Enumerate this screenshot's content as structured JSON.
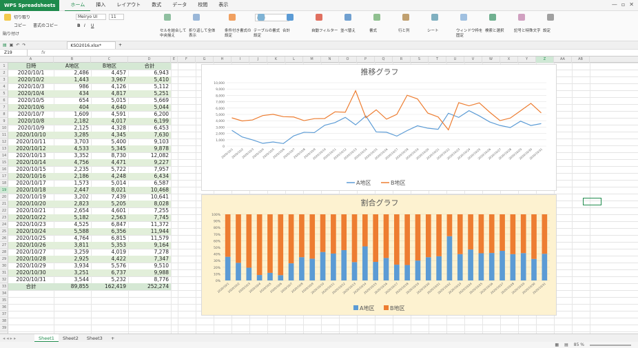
{
  "app": {
    "name": "WPS Spreadsheets",
    "menu": [
      "ホーム",
      "挿入",
      "レイアウト",
      "数式",
      "データ",
      "校閲",
      "表示"
    ],
    "active_menu": 0
  },
  "ribbon": {
    "clipboard": [
      "切り取り",
      "コピー",
      "書式のコピー",
      "貼り付け"
    ],
    "font_name": "Meiryo UI",
    "font_size": "11",
    "number_format": "標準",
    "buttons": [
      "セルを結合して中央揃え",
      "折り返して全体表示",
      "条件付き書式の設定",
      "テーブルの書式設定",
      "合計",
      "自動フィルター",
      "並べ替え",
      "書式",
      "行と列",
      "シート",
      "ウィンドウ枠を固定",
      "検索と選択",
      "記号と特殊文字",
      "設定"
    ]
  },
  "file": {
    "name": "KSO2016.xlsx*"
  },
  "namebox": "Z19",
  "fx": "fx",
  "columns": [
    "A",
    "B",
    "C",
    "D",
    "E",
    "F",
    "G",
    "H",
    "I",
    "J",
    "K",
    "L",
    "M",
    "N",
    "O",
    "P",
    "Q",
    "R",
    "S",
    "T",
    "U",
    "V",
    "W",
    "X",
    "Y",
    "Z",
    "AA",
    "AB"
  ],
  "selected_column": "Z",
  "table": {
    "headers": [
      "日時",
      "A地区",
      "B地区",
      "合計"
    ],
    "rows": [
      [
        "2020/10/1",
        "2,486",
        "4,457",
        "6,943"
      ],
      [
        "2020/10/2",
        "1,443",
        "3,967",
        "5,410"
      ],
      [
        "2020/10/3",
        "986",
        "4,126",
        "5,112"
      ],
      [
        "2020/10/4",
        "434",
        "4,817",
        "5,251"
      ],
      [
        "2020/10/5",
        "654",
        "5,015",
        "5,669"
      ],
      [
        "2020/10/6",
        "404",
        "4,640",
        "5,044"
      ],
      [
        "2020/10/7",
        "1,609",
        "4,591",
        "6,200"
      ],
      [
        "2020/10/8",
        "2,182",
        "4,017",
        "6,199"
      ],
      [
        "2020/10/9",
        "2,125",
        "4,328",
        "6,453"
      ],
      [
        "2020/10/10",
        "3,285",
        "4,345",
        "7,630"
      ],
      [
        "2020/10/11",
        "3,703",
        "5,400",
        "9,103"
      ],
      [
        "2020/10/12",
        "4,533",
        "5,345",
        "9,878"
      ],
      [
        "2020/10/13",
        "3,352",
        "8,730",
        "12,082"
      ],
      [
        "2020/10/14",
        "4,756",
        "4,471",
        "9,227"
      ],
      [
        "2020/10/15",
        "2,235",
        "5,722",
        "7,957"
      ],
      [
        "2020/10/16",
        "2,186",
        "4,248",
        "6,434"
      ],
      [
        "2020/10/17",
        "1,573",
        "5,014",
        "6,587"
      ],
      [
        "2020/10/18",
        "2,447",
        "8,021",
        "10,468"
      ],
      [
        "2020/10/19",
        "3,202",
        "7,439",
        "10,641"
      ],
      [
        "2020/10/20",
        "2,823",
        "5,205",
        "8,028"
      ],
      [
        "2020/10/21",
        "2,654",
        "4,601",
        "7,255"
      ],
      [
        "2020/10/22",
        "5,182",
        "2,563",
        "7,745"
      ],
      [
        "2020/10/23",
        "4,525",
        "6,847",
        "11,372"
      ],
      [
        "2020/10/24",
        "5,588",
        "6,356",
        "11,944"
      ],
      [
        "2020/10/25",
        "4,764",
        "6,815",
        "11,579"
      ],
      [
        "2020/10/26",
        "3,811",
        "5,353",
        "9,164"
      ],
      [
        "2020/10/27",
        "3,259",
        "4,019",
        "7,278"
      ],
      [
        "2020/10/28",
        "2,925",
        "4,422",
        "7,347"
      ],
      [
        "2020/10/29",
        "3,934",
        "5,576",
        "9,510"
      ],
      [
        "2020/10/30",
        "3,251",
        "6,737",
        "9,988"
      ],
      [
        "2020/10/31",
        "3,544",
        "5,232",
        "8,776"
      ]
    ],
    "total": [
      "合計",
      "89,855",
      "162,419",
      "252,274"
    ]
  },
  "chart_data": [
    {
      "type": "line",
      "title": "推移グラフ",
      "x": [
        "2020/10/1",
        "2020/10/2",
        "2020/10/3",
        "2020/10/4",
        "2020/10/5",
        "2020/10/6",
        "2020/10/7",
        "2020/10/8",
        "2020/10/9",
        "2020/10/10",
        "2020/10/11",
        "2020/10/12",
        "2020/10/13",
        "2020/10/14",
        "2020/10/15",
        "2020/10/16",
        "2020/10/17",
        "2020/10/18",
        "2020/10/19",
        "2020/10/20",
        "2020/10/21",
        "2020/10/22",
        "2020/10/23",
        "2020/10/24",
        "2020/10/25",
        "2020/10/26",
        "2020/10/27",
        "2020/10/28",
        "2020/10/29",
        "2020/10/30",
        "2020/10/31"
      ],
      "series": [
        {
          "name": "A地区",
          "color": "#5b9bd5",
          "values": [
            2486,
            1443,
            986,
            434,
            654,
            404,
            1609,
            2182,
            2125,
            3285,
            3703,
            4533,
            3352,
            4756,
            2235,
            2186,
            1573,
            2447,
            3202,
            2823,
            2654,
            5182,
            4525,
            5588,
            4764,
            3811,
            3259,
            2925,
            3934,
            3251,
            3544
          ]
        },
        {
          "name": "B地区",
          "color": "#ed7d31",
          "values": [
            4457,
            3967,
            4126,
            4817,
            5015,
            4640,
            4591,
            4017,
            4328,
            4345,
            5400,
            5345,
            8730,
            4471,
            5722,
            4248,
            5014,
            8021,
            7439,
            5205,
            4601,
            2563,
            6847,
            6356,
            6815,
            5353,
            4019,
            4422,
            5576,
            6737,
            5232
          ]
        }
      ],
      "ylim": [
        0,
        10000
      ],
      "yticks": [
        "0",
        "1,000",
        "2,000",
        "3,000",
        "4,000",
        "5,000",
        "6,000",
        "7,000",
        "8,000",
        "9,000",
        "10,000"
      ],
      "legend": "bottom",
      "grid": true
    },
    {
      "type": "bar",
      "stacked": "percent",
      "title": "割合グラフ",
      "x": [
        "2020/10/1",
        "2020/10/2",
        "2020/10/3",
        "2020/10/4",
        "2020/10/5",
        "2020/10/6",
        "2020/10/7",
        "2020/10/8",
        "2020/10/9",
        "2020/10/10",
        "2020/10/11",
        "2020/10/12",
        "2020/10/13",
        "2020/10/14",
        "2020/10/15",
        "2020/10/16",
        "2020/10/17",
        "2020/10/18",
        "2020/10/19",
        "2020/10/20",
        "2020/10/21",
        "2020/10/22",
        "2020/10/23",
        "2020/10/24",
        "2020/10/25",
        "2020/10/26",
        "2020/10/27",
        "2020/10/28",
        "2020/10/29",
        "2020/10/30",
        "2020/10/31"
      ],
      "series": [
        {
          "name": "A地区",
          "color": "#5b9bd5",
          "values": [
            2486,
            1443,
            986,
            434,
            654,
            404,
            1609,
            2182,
            2125,
            3285,
            3703,
            4533,
            3352,
            4756,
            2235,
            2186,
            1573,
            2447,
            3202,
            2823,
            2654,
            5182,
            4525,
            5588,
            4764,
            3811,
            3259,
            2925,
            3934,
            3251,
            3544
          ]
        },
        {
          "name": "B地区",
          "color": "#ed7d31",
          "values": [
            4457,
            3967,
            4126,
            4817,
            5015,
            4640,
            4591,
            4017,
            4328,
            4345,
            5400,
            5345,
            8730,
            4471,
            5722,
            4248,
            5014,
            8021,
            7439,
            5205,
            4601,
            2563,
            6847,
            6356,
            6815,
            5353,
            4019,
            4422,
            5576,
            6737,
            5232
          ]
        }
      ],
      "ylim": [
        0,
        100
      ],
      "yticks": [
        "0%",
        "10%",
        "20%",
        "30%",
        "40%",
        "50%",
        "60%",
        "70%",
        "80%",
        "90%",
        "100%"
      ],
      "legend": "bottom",
      "background": "#fdf2d0"
    }
  ],
  "sheets": [
    "Sheet1",
    "Sheet2",
    "Sheet3"
  ],
  "active_sheet": 0,
  "add_sheet": "+",
  "zoom": "85 %"
}
